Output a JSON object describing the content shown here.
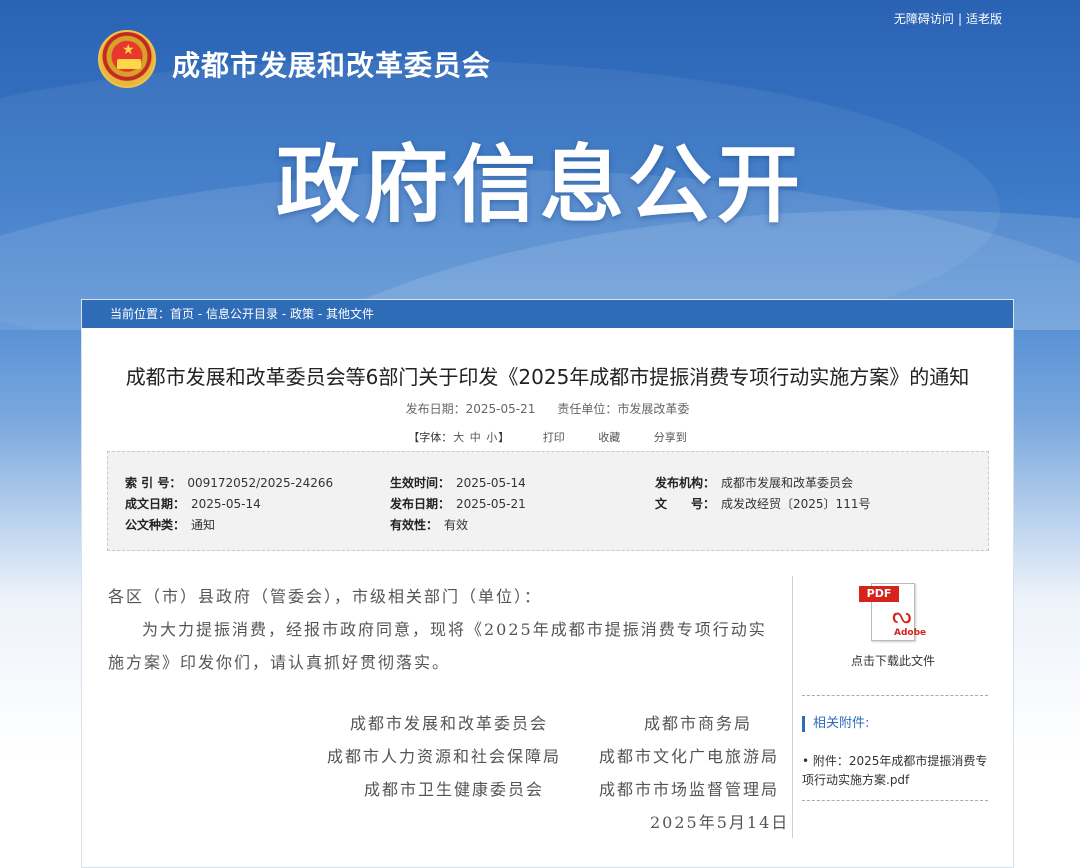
{
  "top_links": {
    "accessible": "无障碍访问",
    "separator": "|",
    "elderly": "适老版"
  },
  "header": {
    "org_name": "成都市发展和改革委员会",
    "banner_title": "政府信息公开"
  },
  "breadcrumb": {
    "label": "当前位置：",
    "items": [
      "首页",
      "信息公开目录",
      "政策",
      "其他文件"
    ],
    "separator": " - "
  },
  "document": {
    "title": "成都市发展和改革委员会等6部门关于印发《2025年成都市提振消费专项行动实施方案》的通知",
    "publish_date_label": "发布日期：",
    "publish_date": "2025-05-21",
    "responsible_label": "责任单位：",
    "responsible": "市发展改革委"
  },
  "tools": {
    "font_label": "【字体：",
    "sizes": [
      "大",
      "中",
      "小"
    ],
    "font_close": "】",
    "print": "打印",
    "favorite": "收藏",
    "share": "分享到"
  },
  "info": {
    "index_no_label": "索 引 号：",
    "index_no": "009172052/2025-24266",
    "effective_time_label": "生效时间：",
    "effective_time": "2025-05-14",
    "issuer_label": "发布机构：",
    "issuer": "成都市发展和改革委员会",
    "written_date_label": "成文日期：",
    "written_date": "2025-05-14",
    "publish_date_label": "发布日期：",
    "publish_date": "2025-05-21",
    "doc_no_label": "文　　号：",
    "doc_no": "成发改经贸〔2025〕111号",
    "doc_type_label": "公文种类：",
    "doc_type": "通知",
    "validity_label": "有效性：",
    "validity": "有效"
  },
  "body": {
    "salutation": "各区（市）县政府（管委会），市级相关部门（单位）：",
    "paragraph": "为大力提振消费，经报市政府同意，现将《2025年成都市提振消费专项行动实施方案》印发你们，请认真抓好贯彻落实。"
  },
  "signatories": [
    "成都市发展和改革委员会",
    "成都市商务局",
    "成都市人力资源和社会保障局",
    "成都市文化广电旅游局",
    "成都市卫生健康委员会",
    "成都市市场监督管理局"
  ],
  "sign_date": "2025年5月14日",
  "sidebar": {
    "pdf_badge": "PDF",
    "pdf_brand": "Adobe",
    "download_label": "点击下载此文件",
    "attach_heading": "相关附件:",
    "attach_item": "• 附件：2025年成都市提振消费专项行动实施方案.pdf"
  },
  "colors": {
    "brand_blue": "#2e6cb8",
    "pdf_red": "#d6231b"
  },
  "icons": [
    "national-emblem-icon",
    "pdf-file-icon"
  ]
}
